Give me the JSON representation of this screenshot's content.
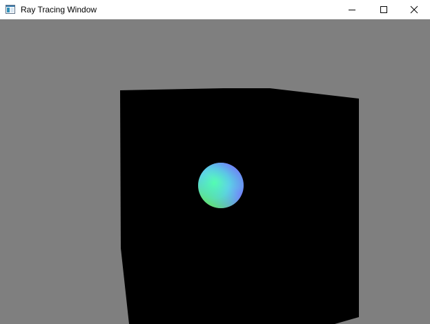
{
  "window": {
    "title": "Ray Tracing Window",
    "controls": {
      "minimize": "minimize",
      "maximize": "maximize",
      "close": "close"
    }
  },
  "scene": {
    "background_color": "#7f7f7f",
    "cube_color": "#000000",
    "sphere_colors": {
      "highlight": "#55ffb0",
      "top": "#7a6bff",
      "left": "#c8ff70",
      "bottom": "#60ff20"
    }
  },
  "icons": {
    "app": "window-app-icon",
    "minimize": "minimize-icon",
    "maximize": "maximize-icon",
    "close": "close-icon"
  }
}
